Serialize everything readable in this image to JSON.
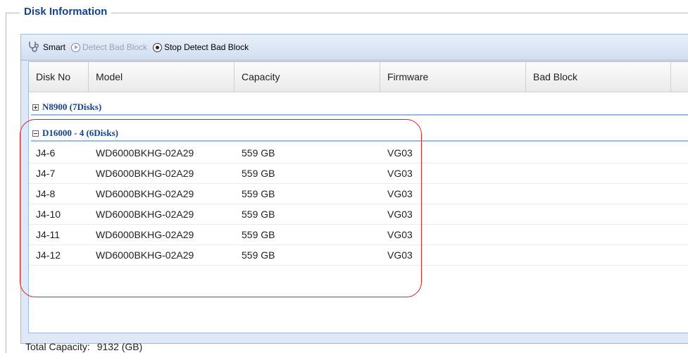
{
  "fieldset": {
    "title": "Disk Information"
  },
  "toolbar": {
    "smart_label": "Smart",
    "detect_label": "Detect Bad Block",
    "stop_label": "Stop Detect Bad Block",
    "smart_icon": "stethoscope-icon",
    "detect_icon": "play-circle-icon",
    "stop_icon": "stop-circle-icon"
  },
  "grid": {
    "columns": [
      "Disk No",
      "Model",
      "Capacity",
      "Firmware",
      "Bad Block"
    ],
    "groups": [
      {
        "label": "N8900 (7Disks)",
        "expanded": false
      },
      {
        "label": "D16000 - 4 (6Disks)",
        "expanded": true
      }
    ],
    "rows": [
      {
        "disk_no": "J4-6",
        "model": "WD6000BKHG-02A29",
        "capacity": "559 GB",
        "firmware": "VG03",
        "bad_block": ""
      },
      {
        "disk_no": "J4-7",
        "model": "WD6000BKHG-02A29",
        "capacity": "559 GB",
        "firmware": "VG03",
        "bad_block": ""
      },
      {
        "disk_no": "J4-8",
        "model": "WD6000BKHG-02A29",
        "capacity": "559 GB",
        "firmware": "VG03",
        "bad_block": ""
      },
      {
        "disk_no": "J4-10",
        "model": "WD6000BKHG-02A29",
        "capacity": "559 GB",
        "firmware": "VG03",
        "bad_block": ""
      },
      {
        "disk_no": "J4-11",
        "model": "WD6000BKHG-02A29",
        "capacity": "559 GB",
        "firmware": "VG03",
        "bad_block": ""
      },
      {
        "disk_no": "J4-12",
        "model": "WD6000BKHG-02A29",
        "capacity": "559 GB",
        "firmware": "VG03",
        "bad_block": ""
      }
    ]
  },
  "footer": {
    "total_label": "Total Capacity:",
    "total_value": "9132 (GB)"
  },
  "colors": {
    "accent": "#15428b",
    "highlight": "#e02020",
    "border": "#99bbe8"
  }
}
